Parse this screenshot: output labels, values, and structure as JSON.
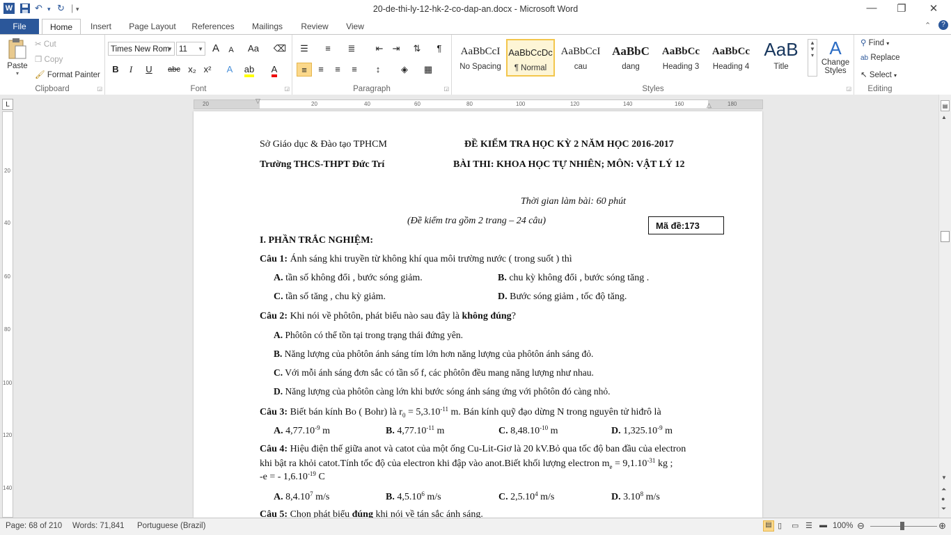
{
  "window": {
    "title": "20-de-thi-ly-12-hk-2-co-dap-an.docx - Microsoft Word",
    "controls": {
      "minimize": "—",
      "restore": "❐",
      "close": "✕"
    }
  },
  "quick_access": {
    "word_icon": "W",
    "save": "💾",
    "undo": "↶",
    "redo": "↻",
    "customize": "▾"
  },
  "tabs": [
    "File",
    "Home",
    "Insert",
    "Page Layout",
    "References",
    "Mailings",
    "Review",
    "View"
  ],
  "active_tab": "Home",
  "ribbon": {
    "clipboard": {
      "paste": "Paste",
      "cut": "Cut",
      "copy": "Copy",
      "format_painter": "Format Painter",
      "label": "Clipboard"
    },
    "font": {
      "font_name": "Times New Rom",
      "font_size": "11",
      "label": "Font",
      "grow": "A",
      "shrink": "A",
      "case": "Aa",
      "bold": "B",
      "italic": "I",
      "underline": "U",
      "strike": "abc",
      "sub": "x₂",
      "sup": "x²"
    },
    "paragraph": {
      "label": "Paragraph",
      "pilcrow": "¶"
    },
    "styles": {
      "label": "Styles",
      "items": [
        {
          "sample": "AaBbCcI",
          "name": "No Spacing"
        },
        {
          "sample": "AaBbCcDc",
          "name": "¶ Normal"
        },
        {
          "sample": "AaBbCcI",
          "name": "cau"
        },
        {
          "sample": "AaBbC",
          "name": "dang"
        },
        {
          "sample": "AaBbCc",
          "name": "Heading 3"
        },
        {
          "sample": "AaBbCc",
          "name": "Heading 4"
        },
        {
          "sample": "AaB",
          "name": "Title"
        }
      ],
      "change_styles": "Change Styles"
    },
    "editing": {
      "label": "Editing",
      "find": "Find",
      "replace": "Replace",
      "select": "Select"
    }
  },
  "ruler": {
    "h_numbers": [
      "20",
      "20",
      "40",
      "60",
      "80",
      "100",
      "120",
      "140",
      "160",
      "180"
    ],
    "v_numbers": [
      "20",
      "40",
      "60",
      "80",
      "100",
      "120",
      "140"
    ]
  },
  "document": {
    "header_left1": "Sở Giáo dục & Đào tạo TPHCM",
    "header_right1": "ĐỀ KIỂM TRA HỌC KỲ 2 NĂM HỌC 2016-2017",
    "header_left2": "Trường THCS-THPT Đức Trí",
    "header_right2": "BÀI THI: KHOA HỌC TỰ NHIÊN; MÔN: VẬT LÝ 12",
    "time": "Thời gian làm bài: 60 phút",
    "pages_note": "(Đề kiểm tra gồm 2 trang – 24 câu)",
    "ma_de": "Mã đề:173",
    "section": "I. PHẦN TRẮC NGHIỆM:",
    "q1": {
      "label": "Câu 1:",
      "text": " Ánh sáng khi truyền từ không khí qua môi trường nước ( trong suốt ) thì",
      "a": "tần số không đổi , bước sóng giảm.",
      "b": "chu kỳ không đổi , bước sóng tăng .",
      "c": "tần số tăng , chu kỳ giảm.",
      "d": "Bước sóng giảm , tốc độ tăng."
    },
    "q2": {
      "label": "Câu 2:",
      "text": " Khi nói về phôtôn, phát biểu nào sau đây là ",
      "bold": "không đúng",
      "end": "?",
      "a": "Phôtôn có thể tồn tại trong trạng thái đứng yên.",
      "b": "Năng lượng của phôtôn ánh sáng tím lớn hơn năng lượng của phôtôn ánh sáng đỏ.",
      "c": "Với mỗi ánh sáng đơn sắc có tần số f, các phôtôn đều mang năng lượng như nhau.",
      "d": "Năng lượng của phôtôn càng lớn khi bước sóng ánh sáng ứng với phôtôn đó càng nhỏ."
    },
    "q3": {
      "label": "Câu 3:",
      "t1": " Biết bán kính Bo ( Bohr) là r",
      "sub": "0",
      "t2": " = 5,3.10",
      "sup": "-11",
      "t3": " m. Bán kính quỹ đạo dừng N trong nguyên tử hiđrô là",
      "a": "4,77.10",
      "a_sup": "-9",
      "a_u": " m",
      "b": "4,77.10",
      "b_sup": "-11",
      "b_u": " m",
      "c": "8,48.10",
      "c_sup": "-10",
      "c_u": " m",
      "d": "1,325.10",
      "d_sup": "-9",
      "d_u": " m"
    },
    "q4": {
      "label": "Câu 4:",
      "line1": " Hiệu điện thế giữa anot và catot của một ống Cu-Lit-Giơ là 20 kV.Bỏ qua tốc độ ban đầu của electron",
      "line2a": "khi bật ra khỏi catot.Tính tốc độ của electron khi đập vào anot.Biết khối lượng electron m",
      "line2sub": "e",
      "line2b": " = 9,1.10",
      "line2sup": "-31",
      "line2c": " kg ;",
      "line3a": " -e = - 1,6.10",
      "line3sup": "-19",
      "line3b": " C",
      "a": "8,4.10",
      "a_sup": "7",
      "a_u": " m/s",
      "b": "4,5.10",
      "b_sup": "6",
      "b_u": " m/s",
      "c": "2,5.10",
      "c_sup": "4",
      "c_u": " m/s",
      "d": "3.10",
      "d_sup": "8",
      "d_u": " m/s"
    },
    "q5": {
      "label": "Câu 5:",
      "t1": " Chọn phát biểu ",
      "bold": "đúng",
      "t2": " khi nói về tán sắc ánh sáng."
    },
    "opt_labels": {
      "a": "A.",
      "b": "B.",
      "c": "C.",
      "d": "D."
    }
  },
  "status": {
    "page": "Page: 68 of 210",
    "words": "Words: 71,841",
    "language": "Portuguese (Brazil)",
    "zoom": "100%"
  }
}
